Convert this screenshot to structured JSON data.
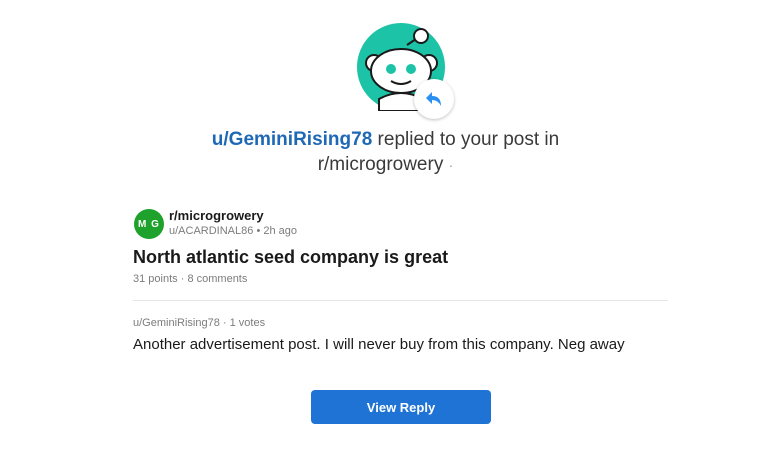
{
  "header": {
    "username": "u/GeminiRising78",
    "action_text": "replied to your post in",
    "subreddit": "r/microgrowery",
    "separator": "·"
  },
  "post": {
    "subreddit_icon_text": "M G",
    "subreddit": "r/microgrowery",
    "author": "u/ACARDINAL86",
    "time": "2h ago",
    "title": "North atlantic seed company is great",
    "points": "31 points",
    "comments": "8 comments"
  },
  "reply": {
    "author": "u/GeminiRising78",
    "votes": "1 votes",
    "body": "Another advertisement post. I will never buy from this company. Neg away"
  },
  "cta": {
    "label": "View Reply"
  },
  "colors": {
    "link": "#1f68b6",
    "button": "#1f73d4",
    "avatar_bg": "#1cc3a6",
    "subreddit_icon": "#1ea22b"
  },
  "icons": {
    "avatar": "snoo-avatar-icon",
    "reply_badge": "reply-arrow-icon"
  }
}
